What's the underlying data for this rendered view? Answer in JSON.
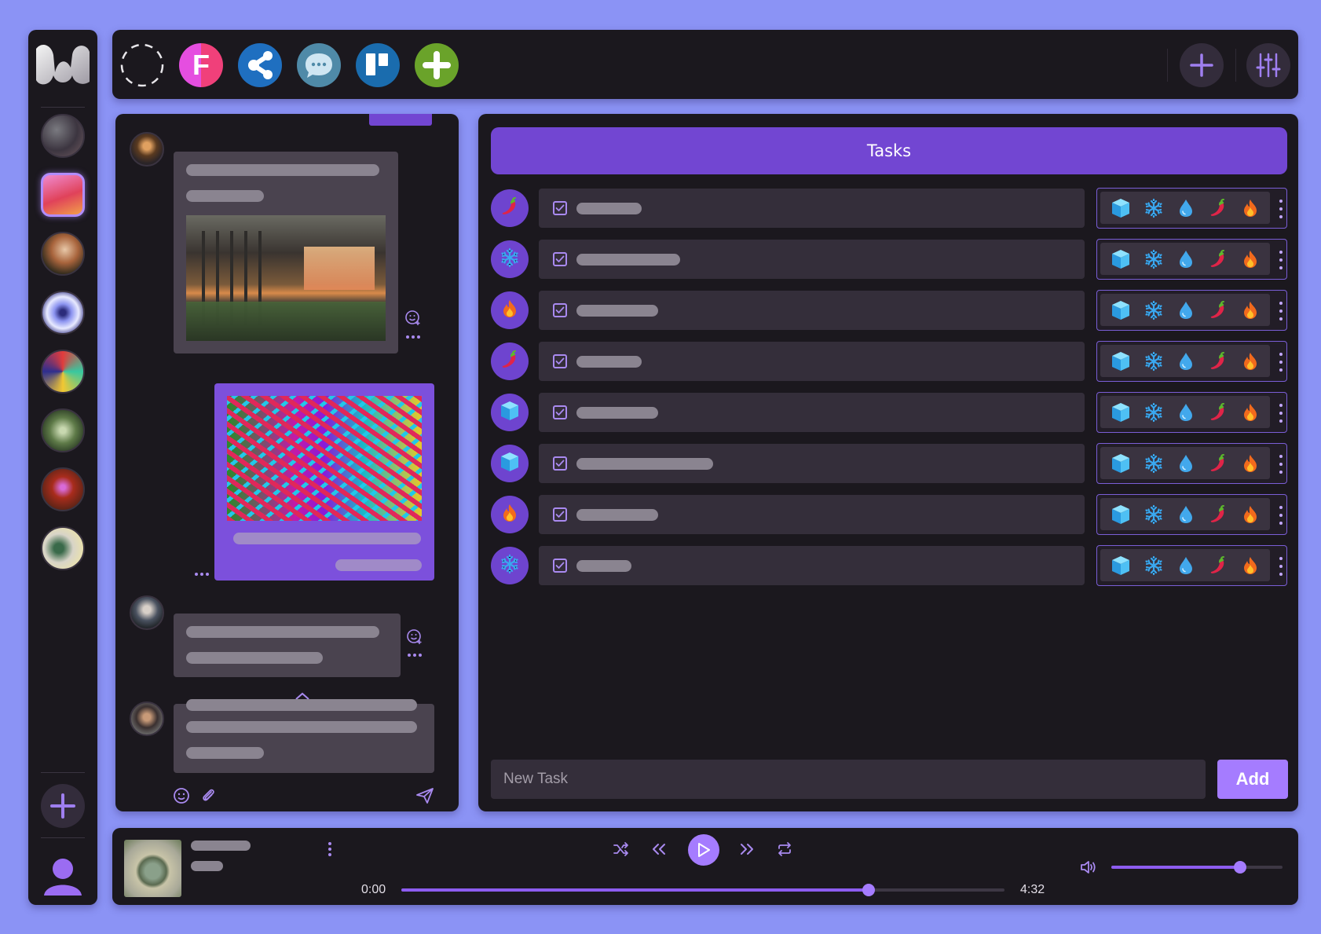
{
  "colors": {
    "background": "#8b93f5",
    "panel": "#1b181e",
    "accent": "#7246d2",
    "accent_light": "#a57cff"
  },
  "topbar": {
    "apps": [
      {
        "name": "spinner-icon"
      },
      {
        "name": "figma-like-f-icon",
        "letter": "F"
      },
      {
        "name": "share-nodes-icon"
      },
      {
        "name": "chat-bubble-icon"
      },
      {
        "name": "trello-board-icon"
      },
      {
        "name": "add-app-icon"
      }
    ],
    "right_buttons": [
      {
        "name": "add-icon"
      },
      {
        "name": "sliders-icon"
      }
    ]
  },
  "sidebar": {
    "servers": [
      {
        "name": "server-abstract",
        "active": false
      },
      {
        "name": "server-coral",
        "active": true
      },
      {
        "name": "server-painting",
        "active": false
      },
      {
        "name": "server-flower",
        "active": false
      },
      {
        "name": "server-shapes",
        "active": false
      },
      {
        "name": "server-circuit",
        "active": false
      },
      {
        "name": "server-tomato",
        "active": false
      },
      {
        "name": "server-devices",
        "active": false
      }
    ]
  },
  "tasks": {
    "title": "Tasks",
    "items": [
      {
        "icon": "chili",
        "text_length": 0.12
      },
      {
        "icon": "snowflake",
        "text_length": 0.19
      },
      {
        "icon": "fire",
        "text_length": 0.15
      },
      {
        "icon": "chili",
        "text_length": 0.12
      },
      {
        "icon": "ice-cube",
        "text_length": 0.15
      },
      {
        "icon": "ice-cube",
        "text_length": 0.25
      },
      {
        "icon": "fire",
        "text_length": 0.15
      },
      {
        "icon": "snowflake",
        "text_length": 0.1
      }
    ],
    "tool_icons": [
      "ice-cube",
      "snowflake",
      "water-drop",
      "chili",
      "fire"
    ],
    "new_task_placeholder": "New Task",
    "add_label": "Add"
  },
  "player": {
    "current_time": "0:00",
    "total_time": "4:32",
    "progress": 0.775,
    "volume": 0.75
  }
}
